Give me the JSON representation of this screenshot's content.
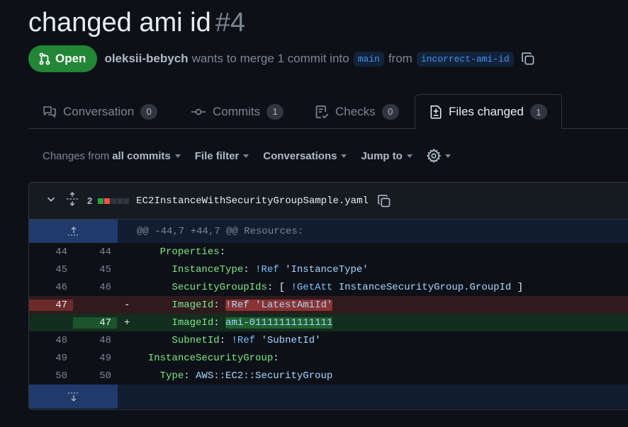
{
  "pr": {
    "title": "changed ami id",
    "number": "#4",
    "status": "Open",
    "author": "oleksii-bebych",
    "merge_text": "wants to merge 1 commit into",
    "base_branch": "main",
    "from_text": "from",
    "head_branch": "incorrect-ami-id"
  },
  "tabs": [
    {
      "label": "Conversation",
      "count": "0",
      "icon": "comment-discussion-icon"
    },
    {
      "label": "Commits",
      "count": "1",
      "icon": "git-commit-icon"
    },
    {
      "label": "Checks",
      "count": "0",
      "icon": "checklist-icon"
    },
    {
      "label": "Files changed",
      "count": "1",
      "icon": "file-diff-icon"
    }
  ],
  "toolbar": {
    "changes_prefix": "Changes from",
    "changes_value": "all commits",
    "file_filter": "File filter",
    "conversations": "Conversations",
    "jump_to": "Jump to"
  },
  "file": {
    "changes": "2",
    "name": "EC2InstanceWithSecurityGroupSample.yaml",
    "hunk": "@@ -44,7 +44,7 @@ Resources:"
  },
  "lines": [
    {
      "old": "44",
      "new": "44"
    },
    {
      "old": "45",
      "new": "45"
    },
    {
      "old": "46",
      "new": "46"
    },
    {
      "old": "47",
      "new": "",
      "sign": "-"
    },
    {
      "old": "",
      "new": "47",
      "sign": "+"
    },
    {
      "old": "48",
      "new": "48"
    },
    {
      "old": "49",
      "new": "49"
    },
    {
      "old": "50",
      "new": "50"
    }
  ],
  "code": {
    "l0_key": "Properties",
    "l1_key": "InstanceType",
    "l1_tag": "!Ref",
    "l1_val": "'InstanceType'",
    "l2_key": "SecurityGroupIds",
    "l2_open": "[",
    "l2_tag": "!GetAtt",
    "l2_val": "InstanceSecurityGroup.GroupId",
    "l2_close": "]",
    "l3_key": "ImageId",
    "l3_val": "!Ref 'LatestAmiId'",
    "l4_key": "ImageId",
    "l4_val": "ami-01111111111111",
    "l5_key": "SubnetId",
    "l5_tag": "!Ref",
    "l5_val": "'SubnetId'",
    "l6_key": "InstanceSecurityGroup",
    "l7_key": "Type",
    "l7_val": "AWS::EC2::SecurityGroup",
    "colon": ":"
  },
  "colors": {
    "open": "#238636",
    "link": "#4493f8",
    "added": "#2ea043",
    "deleted": "#f85149"
  }
}
